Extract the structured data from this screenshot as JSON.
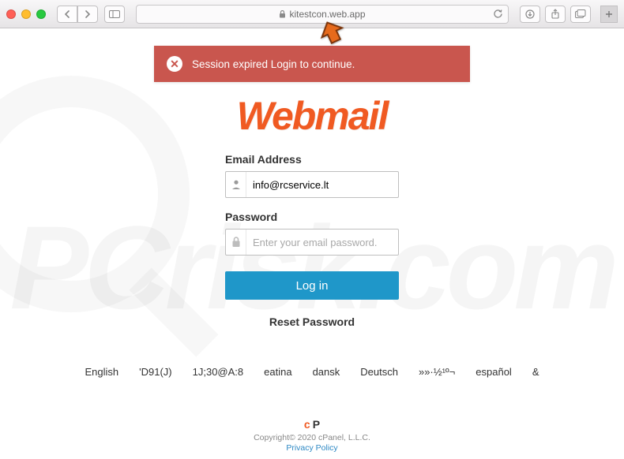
{
  "browser": {
    "url": "kitestcon.web.app"
  },
  "alert": {
    "message": "Session expired Login to continue."
  },
  "logo_text": "Webmail",
  "form": {
    "email_label": "Email Address",
    "email_value": "info@rcservice.lt",
    "password_label": "Password",
    "password_placeholder": "Enter your email password.",
    "password_value": "",
    "submit_label": "Log in",
    "reset_label": "Reset Password"
  },
  "languages": [
    "English",
    "'D91(J)",
    "1J;30@A:8",
    "eatina",
    "dansk",
    "Deutsch",
    "»»·½¹º¬",
    "español",
    "&"
  ],
  "footer": {
    "brand_c": "c",
    "brand_p": "P",
    "copyright": "Copyright© 2020 cPanel, L.L.C.",
    "privacy": "Privacy Policy"
  },
  "watermark": "PCrisk.com",
  "colors": {
    "accent_orange": "#f05a22",
    "alert_red": "#c9564e",
    "button_blue": "#1f97c9"
  }
}
